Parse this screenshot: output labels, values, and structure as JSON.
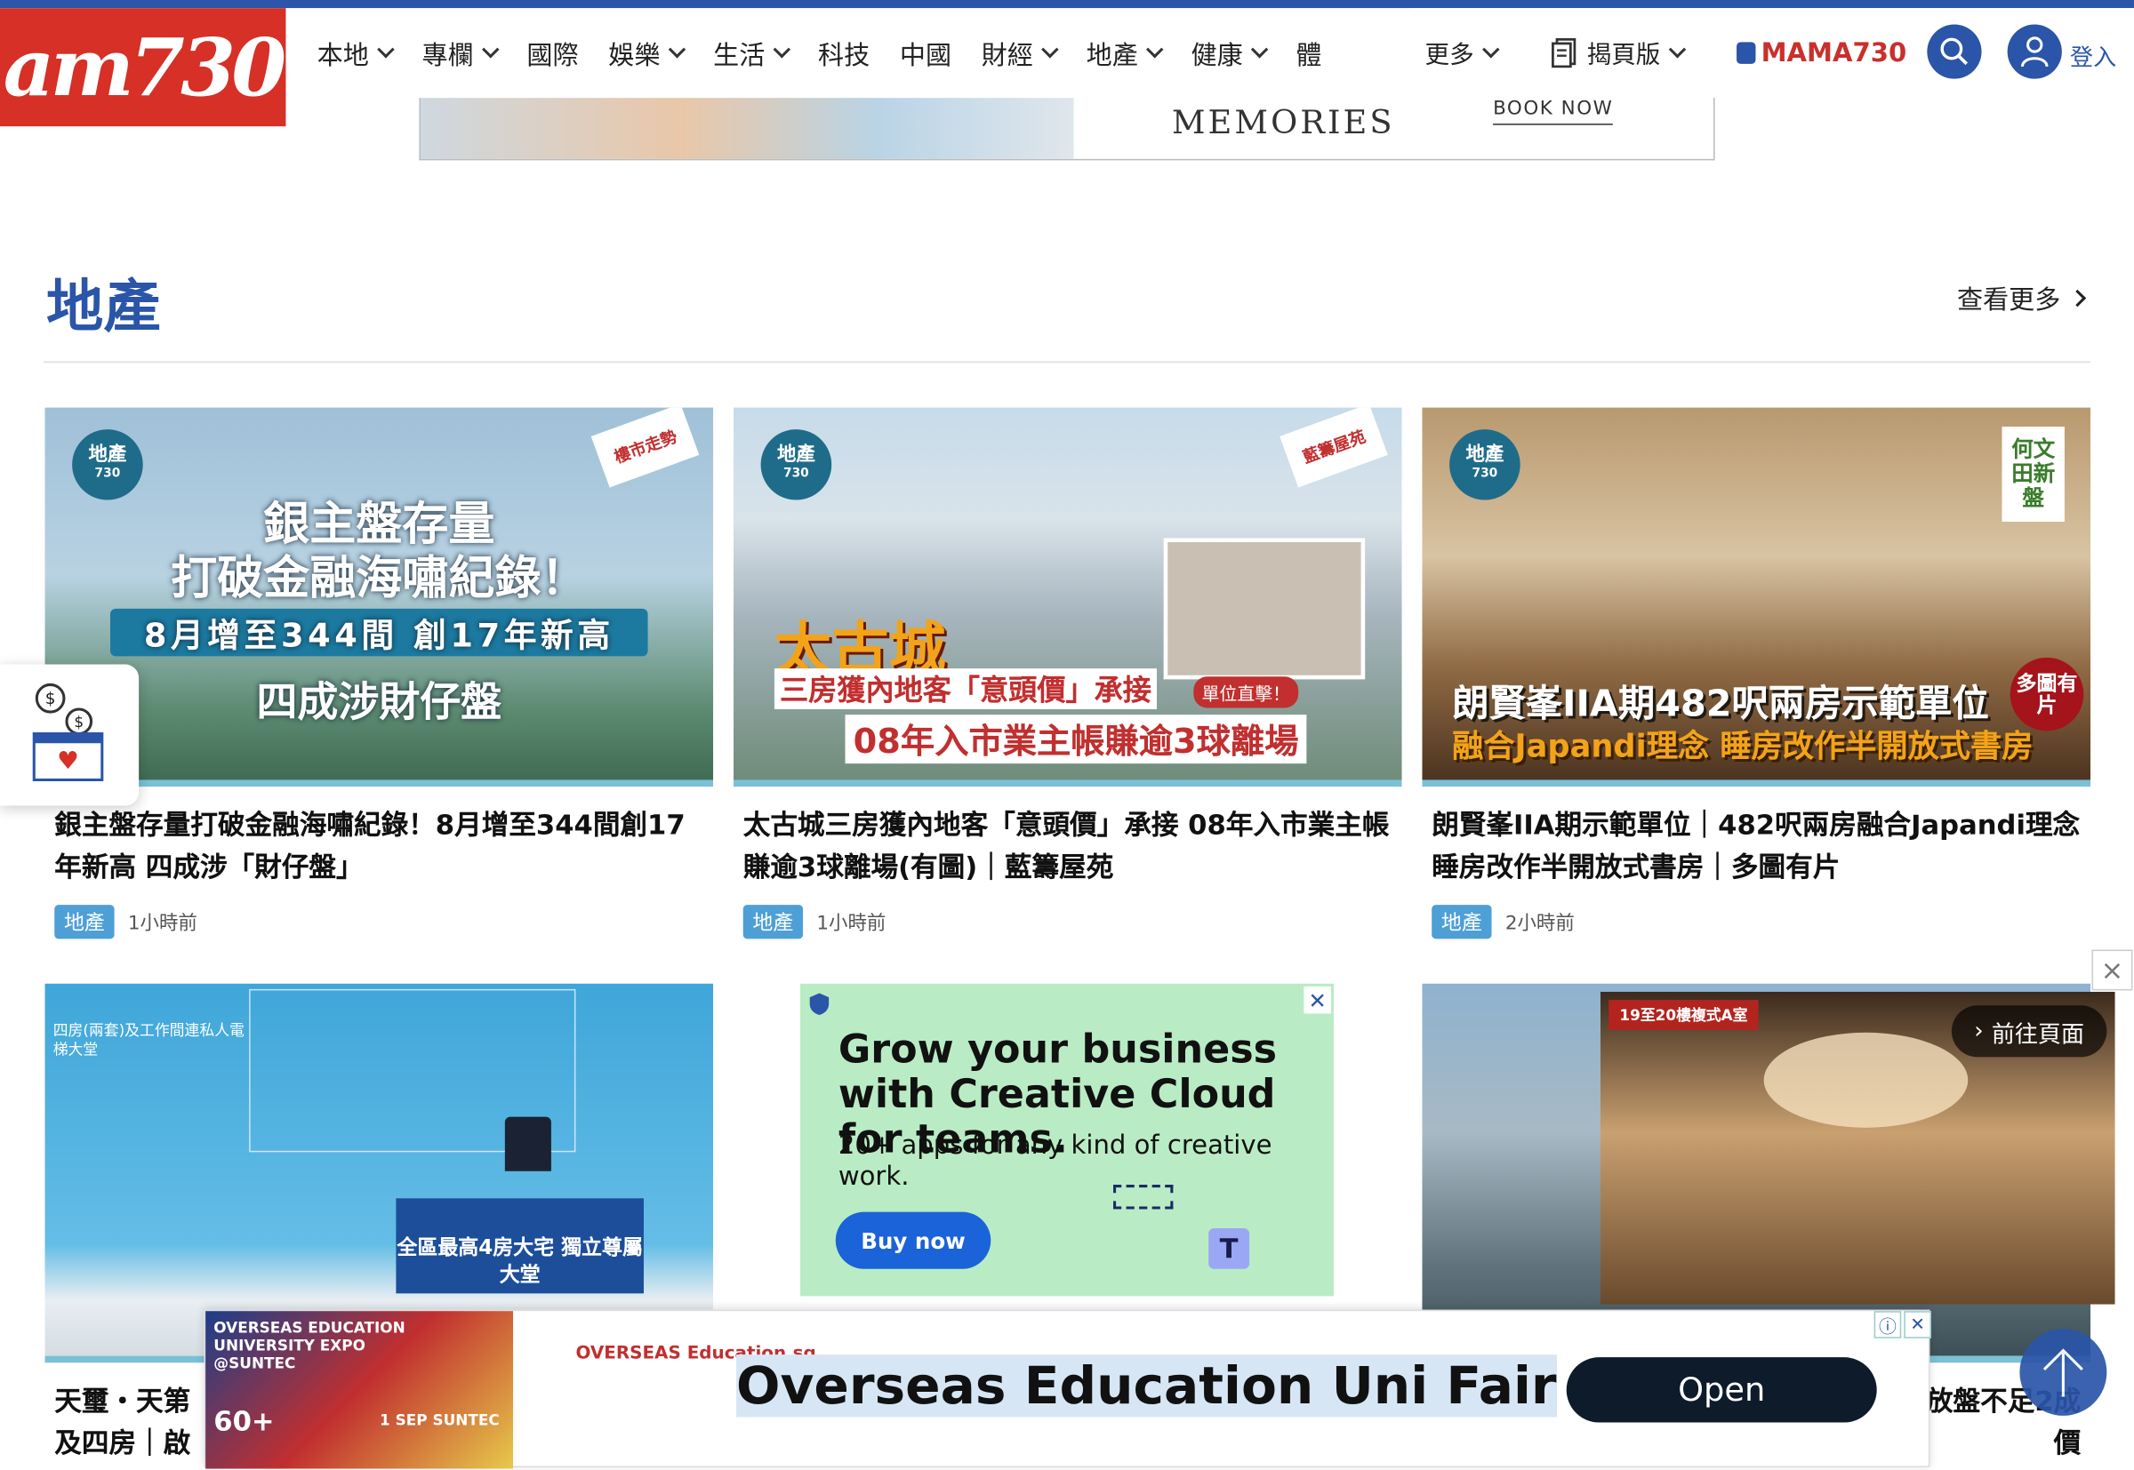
{
  "logo": {
    "text": "am730"
  },
  "nav": {
    "items": [
      {
        "label": "本地",
        "dropdown": true
      },
      {
        "label": "專欄",
        "dropdown": true
      },
      {
        "label": "國際",
        "dropdown": false
      },
      {
        "label": "娛樂",
        "dropdown": true
      },
      {
        "label": "生活",
        "dropdown": true
      },
      {
        "label": "科技",
        "dropdown": false
      },
      {
        "label": "中國",
        "dropdown": false
      },
      {
        "label": "財經",
        "dropdown": true
      },
      {
        "label": "地產",
        "dropdown": true
      },
      {
        "label": "健康",
        "dropdown": true
      },
      {
        "label": "體",
        "dropdown": false
      }
    ],
    "more_label": "更多",
    "epaper_label": "揭頁版",
    "mama_label": "MAMA730",
    "login_label": "登入"
  },
  "top_banner": {
    "text": "MEMORIES",
    "cta": "BOOK NOW"
  },
  "section": {
    "title": "地產",
    "more_label": "查看更多"
  },
  "articles": [
    {
      "thumb_lines": [
        "銀主盤存量",
        "打破金融海嘯紀錄！",
        "8月增至344間 創17年新高",
        "四成涉財仔盤"
      ],
      "thumb_badge": "地產",
      "thumb_badge_sub": "730",
      "thumb_tag": "樓市走勢",
      "title": "銀主盤存量打破金融海嘯紀錄！8月增至344間創17年新高 四成涉「財仔盤」",
      "tag": "地產",
      "time": "1小時前"
    },
    {
      "thumb_lines": [
        "太古城",
        "三房獲內地客「意頭價」承接",
        "08年入市業主帳賺逾3球離場"
      ],
      "thumb_badge": "地產",
      "thumb_badge_sub": "730",
      "thumb_tag": "藍籌屋苑",
      "thumb_tag2": "單位直擊！",
      "title": "太古城三房獲內地客「意頭價」承接 08年入市業主帳賺逾3球離場(有圖)｜藍籌屋苑",
      "tag": "地產",
      "time": "1小時前"
    },
    {
      "thumb_lines": [
        "朗賢峯IIA期482呎兩房示範單位",
        "融合Japandi理念 睡房改作半開放式書房"
      ],
      "thumb_badge": "地產",
      "thumb_badge_sub": "730",
      "thumb_tag": "何文田新盤",
      "thumb_tag2": "多圖有片",
      "title": "朗賢峯IIA期示範單位｜482呎兩房融合Japandi理念 睡房改作半開放式書房｜多圖有片",
      "tag": "地產",
      "time": "2小時前"
    }
  ],
  "row2": {
    "left": {
      "thumb_sign": "全區最高4房大宅 獨立尊屬大堂",
      "thumb_caption": "四房(兩套)及工作間連私人電梯大堂",
      "title_partial_1": "天璽・天第",
      "title_partial_2": "及四房｜啟"
    },
    "right": {
      "video_tag": "19至20樓複式A室",
      "goto_label": "前往頁面",
      "title_partial_1": "放盤不足2成",
      "title_partial_2": "價"
    }
  },
  "ad_cc": {
    "headline": "Grow your business with Creative Cloud for teams.",
    "body": "20+ apps for any kind of creative work.",
    "cta": "Buy now"
  },
  "bottom_ad": {
    "pic_lines": [
      "OVERSEAS EDUCATION",
      "UNIVERSITY EXPO",
      "@SUNTEC",
      "60+",
      "1 SEP SUNTEC"
    ],
    "brand": "OVERSEAS Education.sg",
    "headline": "Overseas Education Uni Fair",
    "cta": "Open"
  },
  "colors": {
    "brand_blue": "#2a55a8",
    "logo_red": "#d63027",
    "tag_blue": "#4e9fd6"
  }
}
